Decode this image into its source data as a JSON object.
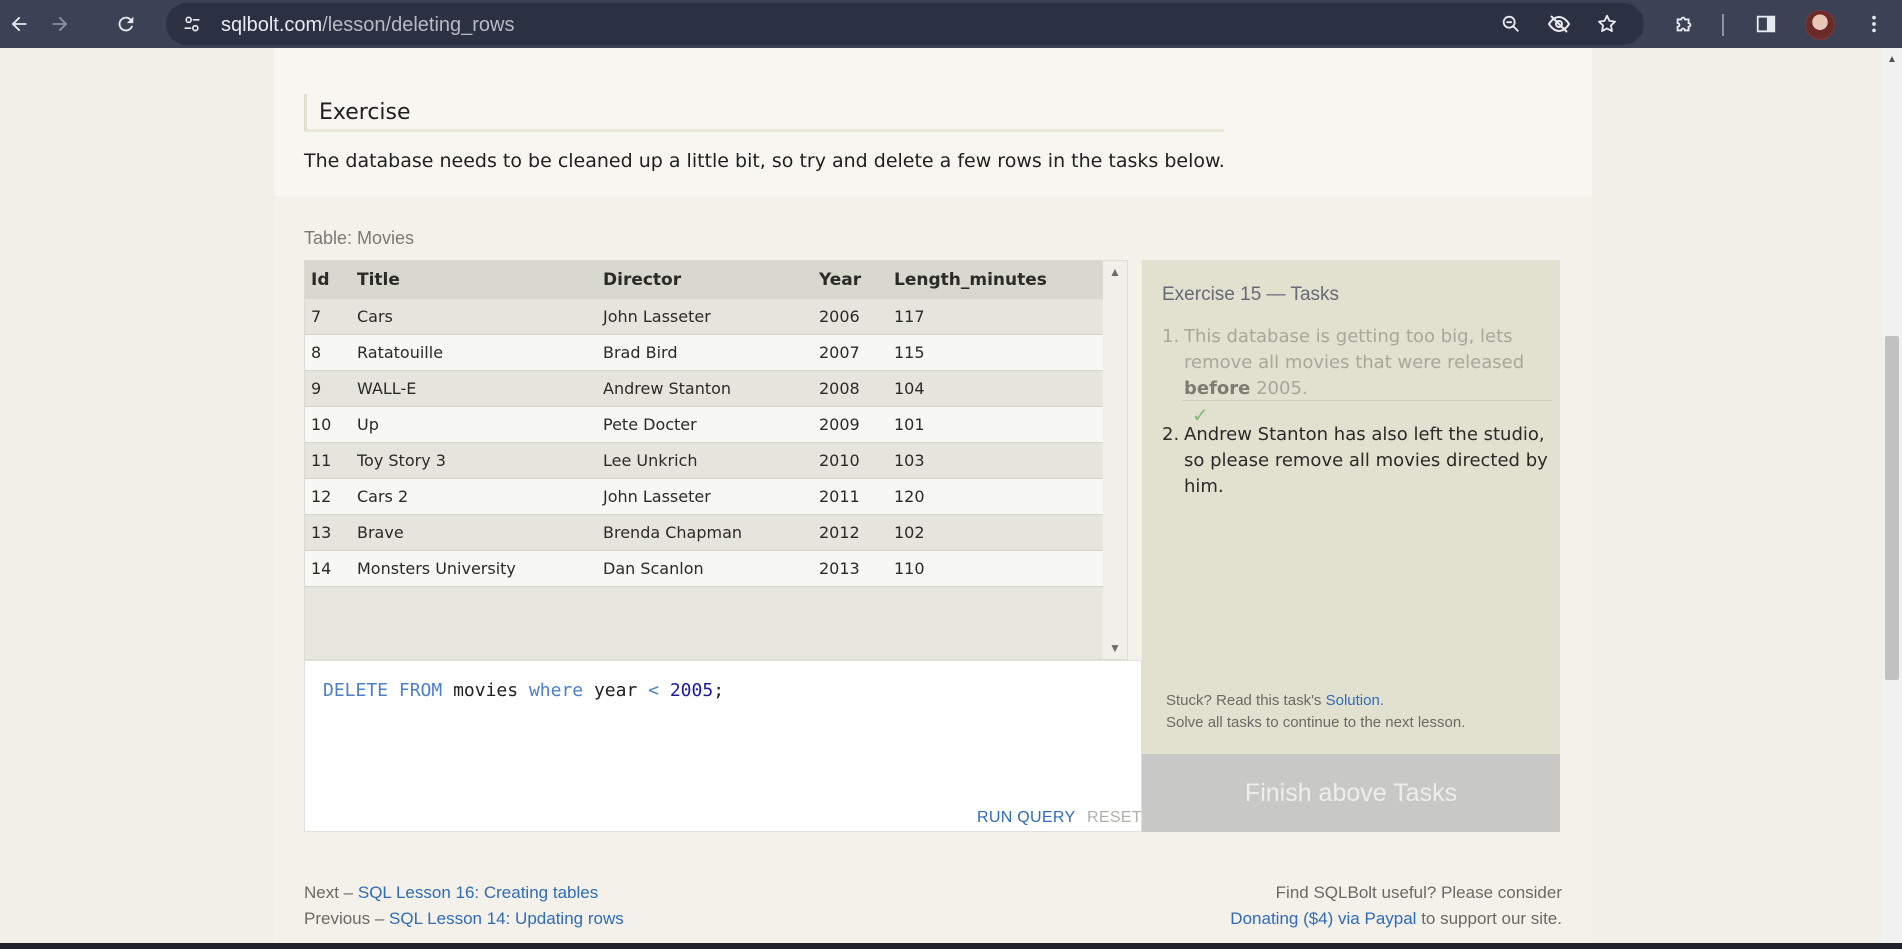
{
  "browser": {
    "url_host": "sqlbolt.com",
    "url_path": "/lesson/deleting_rows"
  },
  "exercise": {
    "heading": "Exercise",
    "description": "The database needs to be cleaned up a little bit, so try and delete a few rows in the tasks below."
  },
  "table": {
    "label": "Table: Movies",
    "columns": [
      "Id",
      "Title",
      "Director",
      "Year",
      "Length_minutes"
    ],
    "rows": [
      [
        "7",
        "Cars",
        "John Lasseter",
        "2006",
        "117"
      ],
      [
        "8",
        "Ratatouille",
        "Brad Bird",
        "2007",
        "115"
      ],
      [
        "9",
        "WALL-E",
        "Andrew Stanton",
        "2008",
        "104"
      ],
      [
        "10",
        "Up",
        "Pete Docter",
        "2009",
        "101"
      ],
      [
        "11",
        "Toy Story 3",
        "Lee Unkrich",
        "2010",
        "103"
      ],
      [
        "12",
        "Cars 2",
        "John Lasseter",
        "2011",
        "120"
      ],
      [
        "13",
        "Brave",
        "Brenda Chapman",
        "2012",
        "102"
      ],
      [
        "14",
        "Monsters University",
        "Dan Scanlon",
        "2013",
        "110"
      ]
    ]
  },
  "editor": {
    "tokens": [
      {
        "t": "DELETE",
        "c": "kw"
      },
      {
        "t": " "
      },
      {
        "t": "FROM",
        "c": "kw"
      },
      {
        "t": " movies "
      },
      {
        "t": "where",
        "c": "kw"
      },
      {
        "t": " year "
      },
      {
        "t": "<",
        "c": "kw"
      },
      {
        "t": " "
      },
      {
        "t": "2005",
        "c": "num"
      },
      {
        "t": ";"
      }
    ],
    "run_label": "RUN QUERY",
    "reset_label": "RESET"
  },
  "tasks": {
    "title": "Exercise 15 — Tasks",
    "task1": {
      "num": "1.",
      "before": "This database is getting too big, lets remove all movies that were released ",
      "bold": "before",
      "after": " 2005.",
      "check": "✓"
    },
    "task2": {
      "num": "2.",
      "text": "Andrew Stanton has also left the studio, so please remove all movies directed by him."
    },
    "stuck_prefix": "Stuck? Read this task's ",
    "solution_link": "Solution",
    "stuck_suffix": ".",
    "continue_note": "Solve all tasks to continue to the next lesson.",
    "finish_label": "Finish above Tasks"
  },
  "footer": {
    "next_prefix": "Next – ",
    "next_link": "SQL Lesson 16: Creating tables",
    "prev_prefix": "Previous – ",
    "prev_link": "SQL Lesson 14: Updating rows",
    "right_line1": "Find SQLBolt useful? Please consider",
    "donate_link": "Donating ($4) via Paypal",
    "right_suffix": " to support our site."
  }
}
